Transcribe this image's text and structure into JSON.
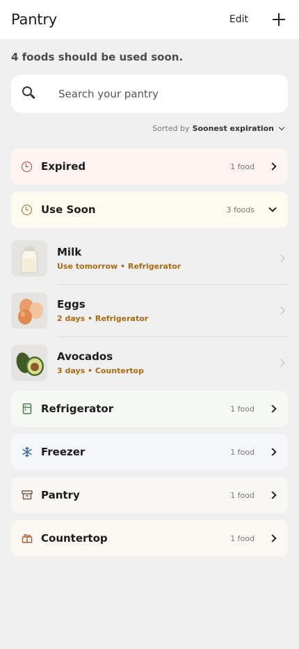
{
  "header": {
    "title": "Pantry",
    "edit_label": "Edit"
  },
  "summary": "4 foods should be used soon.",
  "search": {
    "placeholder": "Search your pantry",
    "value": ""
  },
  "sort": {
    "prefix": "Sorted by",
    "value": "Soonest expiration"
  },
  "sections": {
    "expired": {
      "label": "Expired",
      "count": "1 food",
      "bg": "#fdf3f1",
      "icon": "clock-icon",
      "icon_color": "#b23b3b"
    },
    "use_soon": {
      "label": "Use Soon",
      "count": "3 foods",
      "bg": "#fdfaf0",
      "icon": "clock-icon",
      "icon_color": "#9b6a12"
    }
  },
  "items": [
    {
      "name": "Milk",
      "detail": "Use tomorrow • Refrigerator",
      "icon": "milk-bottle-image"
    },
    {
      "name": "Eggs",
      "detail": "2 days • Refrigerator",
      "icon": "eggs-image"
    },
    {
      "name": "Avocados",
      "detail": "3 days • Countertop",
      "icon": "avocado-image"
    }
  ],
  "locations": [
    {
      "label": "Refrigerator",
      "count": "1 food",
      "bg": "#f5f8f3",
      "icon": "refrigerator-icon",
      "icon_color": "#4f7a55"
    },
    {
      "label": "Freezer",
      "count": "1 food",
      "bg": "#f4f6f9",
      "icon": "snowflake-icon",
      "icon_color": "#3a6a98"
    },
    {
      "label": "Pantry",
      "count": "1 food",
      "bg": "#f8f6f2",
      "icon": "storage-box-icon",
      "icon_color": "#7a5a48"
    },
    {
      "label": "Countertop",
      "count": "1 food",
      "bg": "#fbf7f3",
      "icon": "countertop-icon",
      "icon_color": "#a8643a"
    }
  ]
}
